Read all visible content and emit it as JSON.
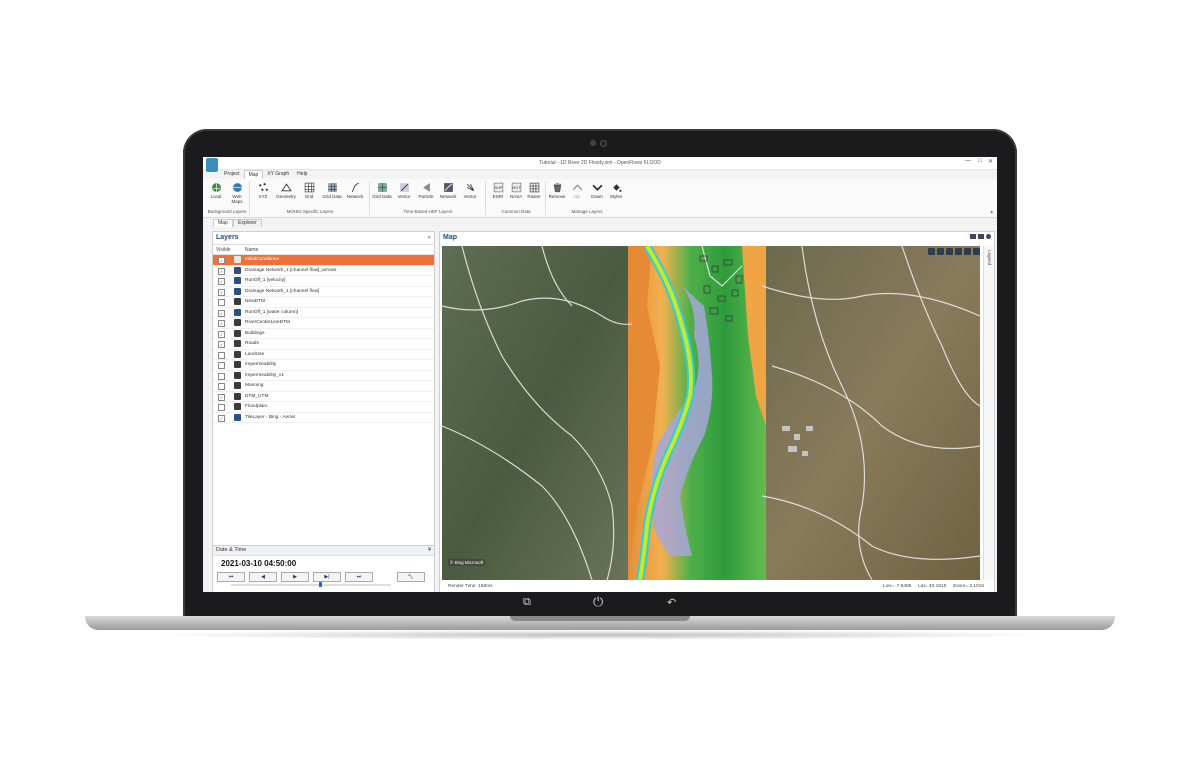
{
  "window": {
    "title": "Tutorial - 1D River 2D Floody.xim - OpenFlows FLOOD",
    "controls": [
      "—",
      "□",
      "✕"
    ]
  },
  "menu": [
    {
      "label": "Project",
      "active": false
    },
    {
      "label": "Map",
      "active": true
    },
    {
      "label": "XY Graph",
      "active": false
    },
    {
      "label": "Help",
      "active": false
    }
  ],
  "ribbon": {
    "groups": [
      {
        "label": "Background Layers",
        "buttons": [
          "Local",
          "Web Maps"
        ]
      },
      {
        "label": "MOHID Specific Layers",
        "buttons": [
          "XYZ",
          "Geometry",
          "Grid",
          "Grid Data",
          "Network"
        ]
      },
      {
        "label": "Time Based HDF Layers",
        "buttons": [
          "Grid Data",
          "Vector",
          "Particle",
          "Network",
          "Vector"
        ]
      },
      {
        "label": "Common Data",
        "buttons": [
          "ESRI",
          "NASA",
          "Raster"
        ]
      },
      {
        "label": "Manage Layers",
        "buttons": [
          "Remove",
          "Up",
          "Down",
          "Styles"
        ]
      }
    ]
  },
  "doc_tabs": [
    "Map",
    "Explorer"
  ],
  "layers_panel": {
    "title": "Layers",
    "columns": [
      "Visible",
      "Name"
    ],
    "rows": [
      {
        "name": "InitialConditions",
        "checked": true,
        "selected": true
      },
      {
        "name": "Drainage Network_1 [channel flow]_arrows",
        "checked": true,
        "selected": false
      },
      {
        "name": "RunOff_1 [velocity]",
        "checked": true,
        "selected": false
      },
      {
        "name": "Drainage Network_1 [channel flow]",
        "checked": true,
        "selected": false
      },
      {
        "name": "NewDTM",
        "checked": false,
        "selected": false
      },
      {
        "name": "RunOff_1 [water column]",
        "checked": true,
        "selected": false
      },
      {
        "name": "RiverCenterLineDTM",
        "checked": true,
        "selected": false
      },
      {
        "name": "Buildings",
        "checked": true,
        "selected": false
      },
      {
        "name": "Roads",
        "checked": true,
        "selected": false
      },
      {
        "name": "LandUse",
        "checked": false,
        "selected": false
      },
      {
        "name": "Impermeability",
        "checked": false,
        "selected": false
      },
      {
        "name": "Impermeability_v1",
        "checked": false,
        "selected": false
      },
      {
        "name": "Manning",
        "checked": false,
        "selected": false
      },
      {
        "name": "DTM_UTM",
        "checked": true,
        "selected": false
      },
      {
        "name": "Floodplain",
        "checked": false,
        "selected": false
      },
      {
        "name": "TileLayer - Bing - Aerial",
        "checked": true,
        "selected": false
      }
    ]
  },
  "datetime_panel": {
    "title": "Date & Time",
    "value": "2021-03-10 04:50:00",
    "buttons": [
      "⏮",
      "◀",
      "▶",
      "▶|",
      "⏭",
      "🔧"
    ],
    "slider_position": 0.55
  },
  "map_panel": {
    "title": "Map",
    "side_label": "Legend",
    "attribution": "© Bing Microsoft",
    "status_left": "Render Time: 168ms",
    "status_right": "Lon= -7.6495     Lat= 40.1815     Zoom= 2.1015"
  },
  "colors": {
    "accent": "#1f4e79",
    "selected_row": "#f0703a",
    "laptop_frame": "#1b1b1d"
  }
}
